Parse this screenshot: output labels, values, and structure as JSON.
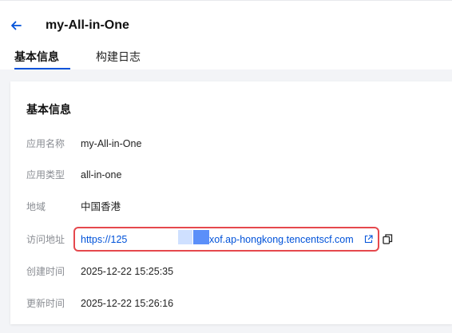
{
  "header": {
    "title": "my-All-in-One",
    "tabs": [
      {
        "label": "基本信息",
        "active": true
      },
      {
        "label": "构建日志",
        "active": false
      }
    ]
  },
  "card": {
    "title": "基本信息",
    "fields": [
      {
        "label": "应用名称",
        "value": "my-All-in-One"
      },
      {
        "label": "应用类型",
        "value": "all-in-one"
      },
      {
        "label": "地域",
        "value": "中国香港"
      },
      {
        "label": "访问地址",
        "url_start": "https://125",
        "url_end": "xof.ap-hongkong.tencentscf.com"
      },
      {
        "label": "创建时间",
        "value": "2025-12-22 15:25:35"
      },
      {
        "label": "更新时间",
        "value": "2025-12-22 15:26:16"
      }
    ]
  },
  "icons": {
    "back": "arrow-left-icon",
    "external": "external-link-icon",
    "copy": "copy-icon"
  },
  "colors": {
    "accent": "#0052d9",
    "highlight_border": "#e5484d",
    "background": "#f3f4f7"
  }
}
